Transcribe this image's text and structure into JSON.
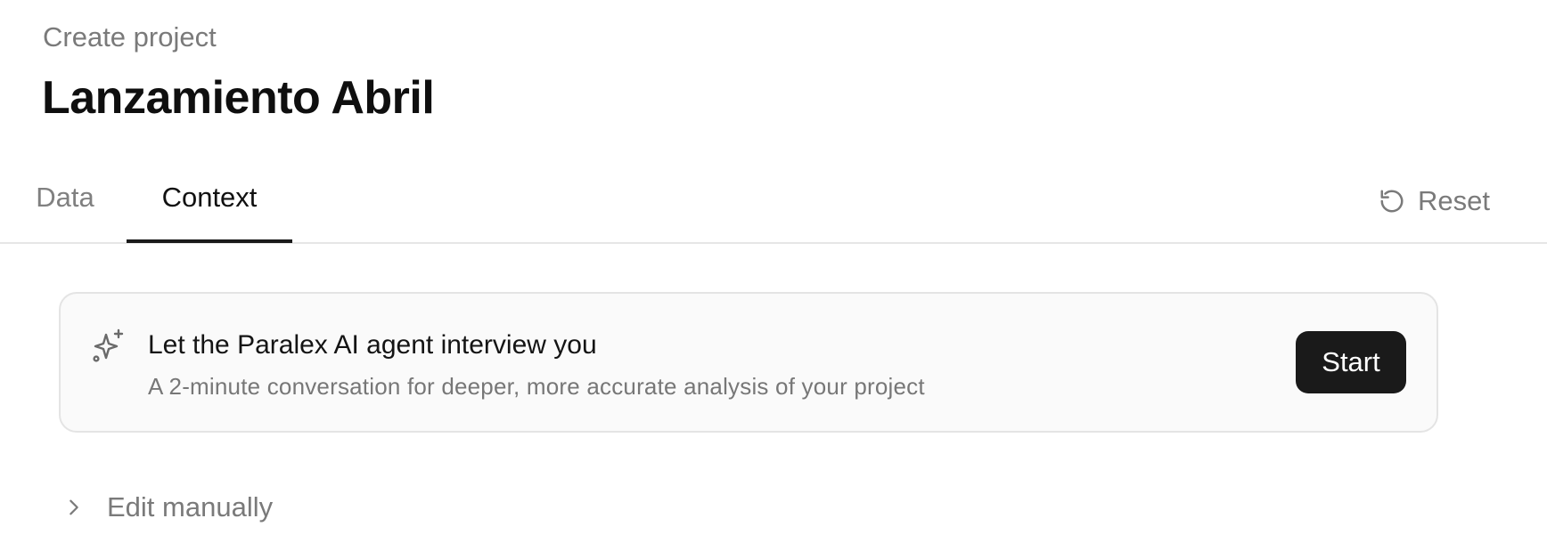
{
  "header": {
    "breadcrumb": "Create project",
    "title": "Lanzamiento Abril"
  },
  "tabs": [
    {
      "label": "Data",
      "active": false
    },
    {
      "label": "Context",
      "active": true
    }
  ],
  "toolbar": {
    "reset_label": "Reset",
    "reset_icon": "reset-icon"
  },
  "agent_card": {
    "icon": "sparkle-icon",
    "title": "Let the Paralex AI agent interview you",
    "subtitle": "A 2-minute conversation for deeper, more accurate analysis of your project",
    "start_label": "Start"
  },
  "edit_manually": {
    "icon": "chevron-right-icon",
    "label": "Edit manually",
    "expanded": false
  },
  "colors": {
    "primary_button": "#1a1a1a",
    "muted_text": "#7a7a7a",
    "card_background": "#fafafa",
    "border": "#e4e4e4"
  }
}
